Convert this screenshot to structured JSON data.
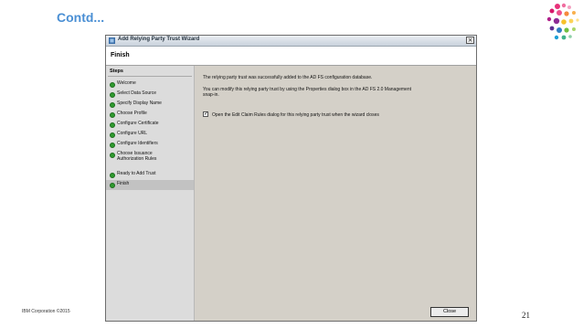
{
  "slide": {
    "title": "Contd...",
    "footer": "IBM Corporation ©2015",
    "page_number": "21"
  },
  "window": {
    "title": "Add Relying Party Trust Wizard",
    "close_glyph": "×",
    "header": "Finish"
  },
  "steps": {
    "heading": "Steps",
    "items": [
      {
        "label": "Welcome"
      },
      {
        "label": "Select Data Source"
      },
      {
        "label": "Specify Display Name"
      },
      {
        "label": "Choose Profile"
      },
      {
        "label": "Configure Certificate"
      },
      {
        "label": "Configure URL"
      },
      {
        "label": "Configure Identifiers"
      },
      {
        "label": "Choose Issuance Authorization Rules"
      },
      {
        "label": "Ready to Add Trust"
      },
      {
        "label": "Finish"
      }
    ],
    "active_index": 9,
    "dot_color": "#2f9a2f"
  },
  "content": {
    "line1": "The relying party trust was successfully added to the AD FS configuration database.",
    "line2a": "You can modify this relying party trust by using the Properties dialog box in the AD FS 2.0 Management",
    "line2b": "snap-in.",
    "checkbox_label": "Open the Edit Claim Rules dialog for this relying party trust when the wizard closes",
    "checkbox_checked": true,
    "checkbox_glyph": "✓",
    "close_button": "Close"
  },
  "colors": {
    "title_blue": "#4a8fd4",
    "window_bg": "#d4d0c8"
  }
}
